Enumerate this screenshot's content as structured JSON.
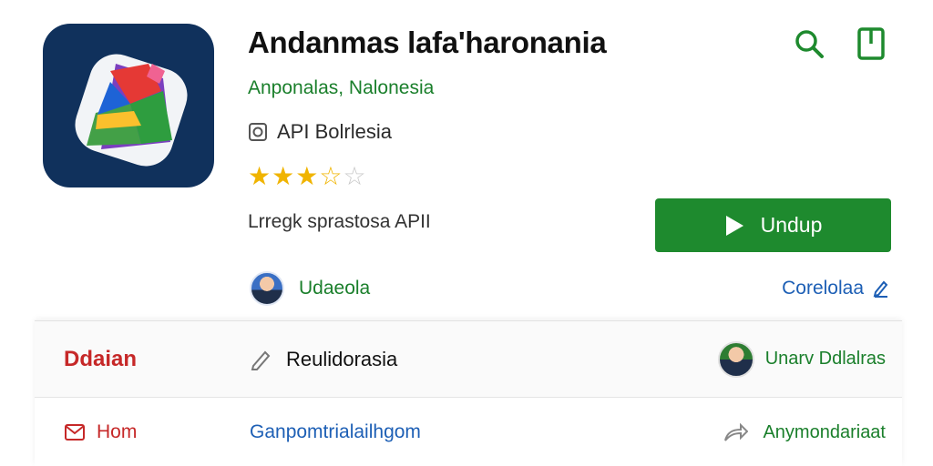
{
  "app": {
    "title": "Andanmas lafa'haronania",
    "developer": "Anponalas, Nalonesia",
    "api_label": "API Bolrlesia",
    "rating": 3.5,
    "rating_max": 5,
    "subtitle": "Lrregk sprastosa APII",
    "install_label": "Undup"
  },
  "author": {
    "name": "Udaeola"
  },
  "edit_link": {
    "label": "Corelolaa"
  },
  "card": {
    "row1": {
      "tab_label": "Ddaian",
      "review_label": "Reulidorasia",
      "user_label": "Unarv Ddlalras"
    },
    "row2": {
      "mail_label": "Hom",
      "link_label": "Ganpomtrialailhgom",
      "share_label": "Anymondariaat"
    }
  },
  "colors": {
    "brand_green": "#1e8a2e",
    "icon_bg": "#10315c",
    "link_blue": "#1d5fb5",
    "accent_red": "#c62828"
  },
  "icons": [
    "app-logo-icon",
    "search-icon",
    "bookmark-icon",
    "api-badge-icon",
    "star-icon",
    "play-icon",
    "edit-icon",
    "pencil-icon",
    "mail-icon",
    "share-arrow-icon"
  ]
}
